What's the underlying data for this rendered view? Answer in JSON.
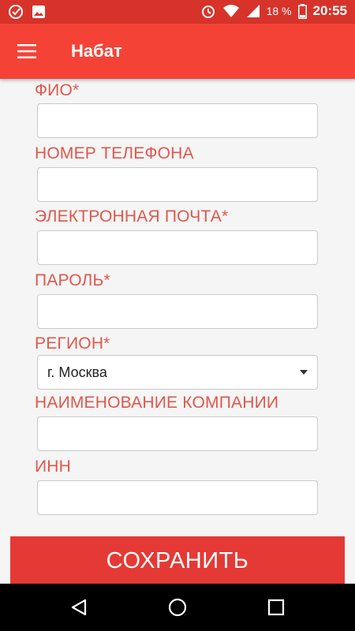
{
  "status_bar": {
    "battery_percent": "18 %",
    "time": "20:55",
    "icons": [
      "sberbank-icon",
      "image-icon",
      "alarm-icon",
      "wifi-icon",
      "signal-icon",
      "battery-icon"
    ]
  },
  "app_bar": {
    "title": "Набат",
    "menu_icon": "hamburger-menu-icon"
  },
  "form": {
    "fio_label": "ФИО*",
    "fio_value": "",
    "phone_label": "НОМЕР ТЕЛЕФОНА",
    "phone_value": "",
    "email_label": "ЭЛЕКТРОННАЯ ПОЧТА*",
    "email_value": "",
    "password_label": "ПАРОЛЬ*",
    "password_value": "",
    "region_label": "РЕГИОН*",
    "region_value": "г. Москва",
    "company_label": "НАИМЕНОВАНИЕ КОМПАНИИ",
    "company_value": "",
    "inn_label": "ИНН",
    "inn_value": ""
  },
  "save_button": {
    "label": "СОХРАНИТЬ"
  },
  "nav_bar": {
    "icons": [
      "back-icon",
      "home-icon",
      "recents-icon"
    ]
  },
  "colors": {
    "status_bar": "#d7332a",
    "app_bar": "#f44336",
    "label": "#e0574c",
    "save_button": "#e53935"
  }
}
